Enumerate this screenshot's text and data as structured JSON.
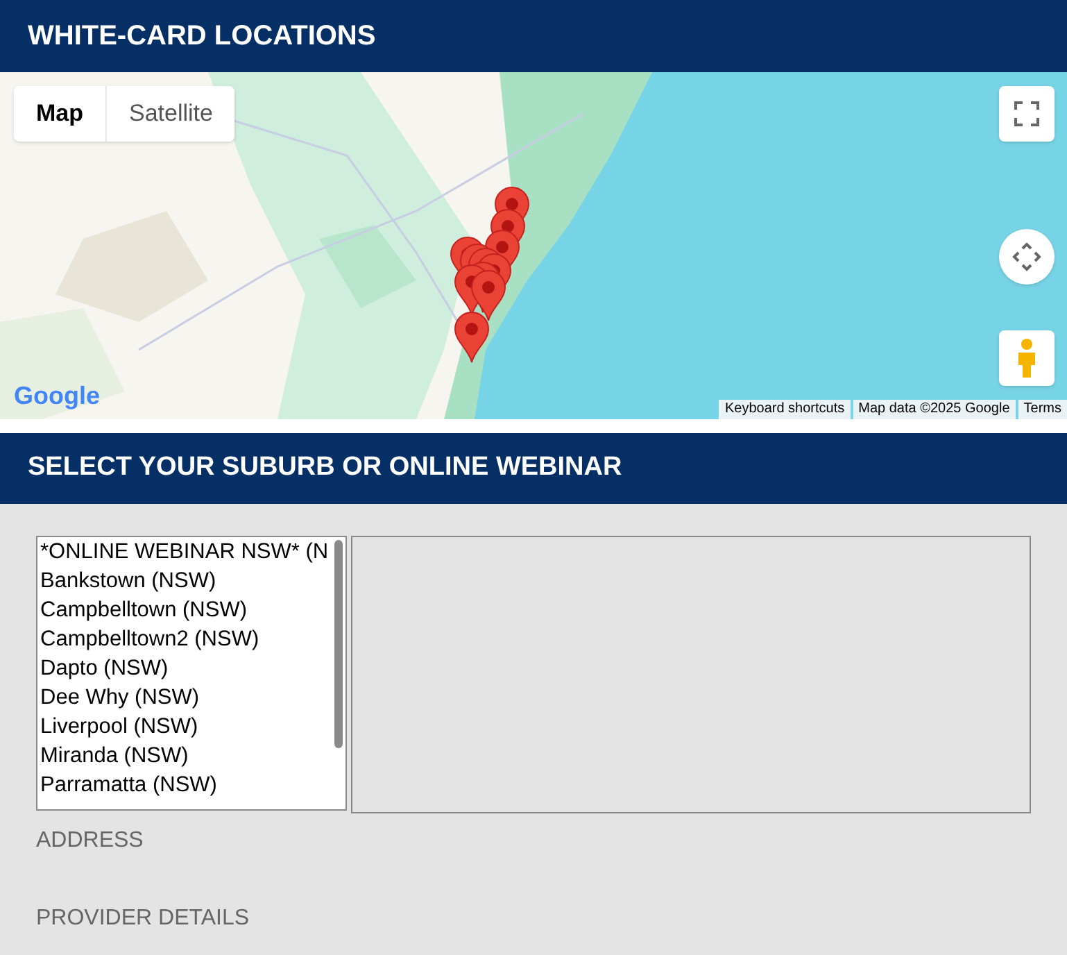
{
  "header": {
    "title": "WHITE-CARD LOCATIONS"
  },
  "map": {
    "type_tabs": [
      {
        "label": "Map",
        "selected": true
      },
      {
        "label": "Satellite",
        "selected": false
      }
    ],
    "logo": "Google",
    "footer_links": [
      "Keyboard shortcuts",
      "Map data ©2025 Google",
      "Terms"
    ]
  },
  "section": {
    "title": "SELECT YOUR SUBURB OR ONLINE WEBINAR"
  },
  "suburbs": [
    "*ONLINE WEBINAR NSW* (N",
    "Bankstown (NSW)",
    "Campbelltown (NSW)",
    "Campbelltown2 (NSW)",
    "Dapto (NSW)",
    "Dee Why (NSW)",
    "Liverpool (NSW)",
    "Miranda (NSW)",
    "Parramatta (NSW)"
  ],
  "labels": [
    "ADDRESS",
    "PROVIDER DETAILS"
  ]
}
